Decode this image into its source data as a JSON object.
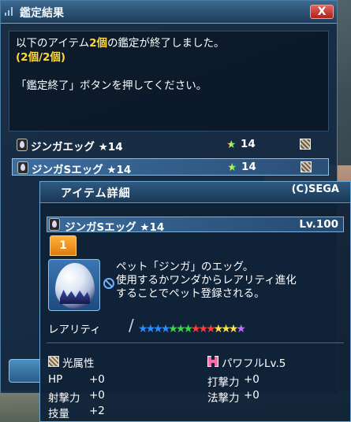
{
  "window": {
    "title": "鑑定結果",
    "close_label": "X"
  },
  "message": {
    "line1_prefix": "以下のアイテム",
    "line1_count": "2個",
    "line1_suffix": "の鑑定が終了しました。",
    "line2": "(2個/2個)",
    "line3": "「鑑定終了」ボタンを押してください。"
  },
  "items": [
    {
      "name": "ジンガエッグ ★14",
      "rarity": "14",
      "selected": false
    },
    {
      "name": "ジンガSエッグ ★14",
      "rarity": "14",
      "selected": true
    }
  ],
  "detail": {
    "title": "アイテム詳細",
    "copyright": "(C)SEGA",
    "item_name": "ジンガSエッグ ★14",
    "level": "Lv.100",
    "tab": "1",
    "description": [
      "ペット「ジンガ」のエッグ。",
      "使用するかワンダからレアリティ進化",
      "することでペット登録される。"
    ],
    "rarity_label": "レアリティ",
    "rarity_stars": 14,
    "star_colors": [
      "#2a8cff",
      "#2a8cff",
      "#2a8cff",
      "#2a8cff",
      "#3ad44a",
      "#3ad44a",
      "#3ad44a",
      "#ff3a3a",
      "#ff3a3a",
      "#ff3a3a",
      "#ffe04a",
      "#ffe04a",
      "#ffe04a",
      "#c46aff"
    ],
    "element": "光属性",
    "potential": "パワフルLv.5",
    "stats": [
      {
        "label": "HP",
        "value": "+0"
      },
      {
        "label": "打撃力",
        "value": "+0"
      },
      {
        "label": "射撃力",
        "value": "+0"
      },
      {
        "label": "法撃力",
        "value": "+0"
      },
      {
        "label": "技量",
        "value": "+2"
      }
    ]
  }
}
